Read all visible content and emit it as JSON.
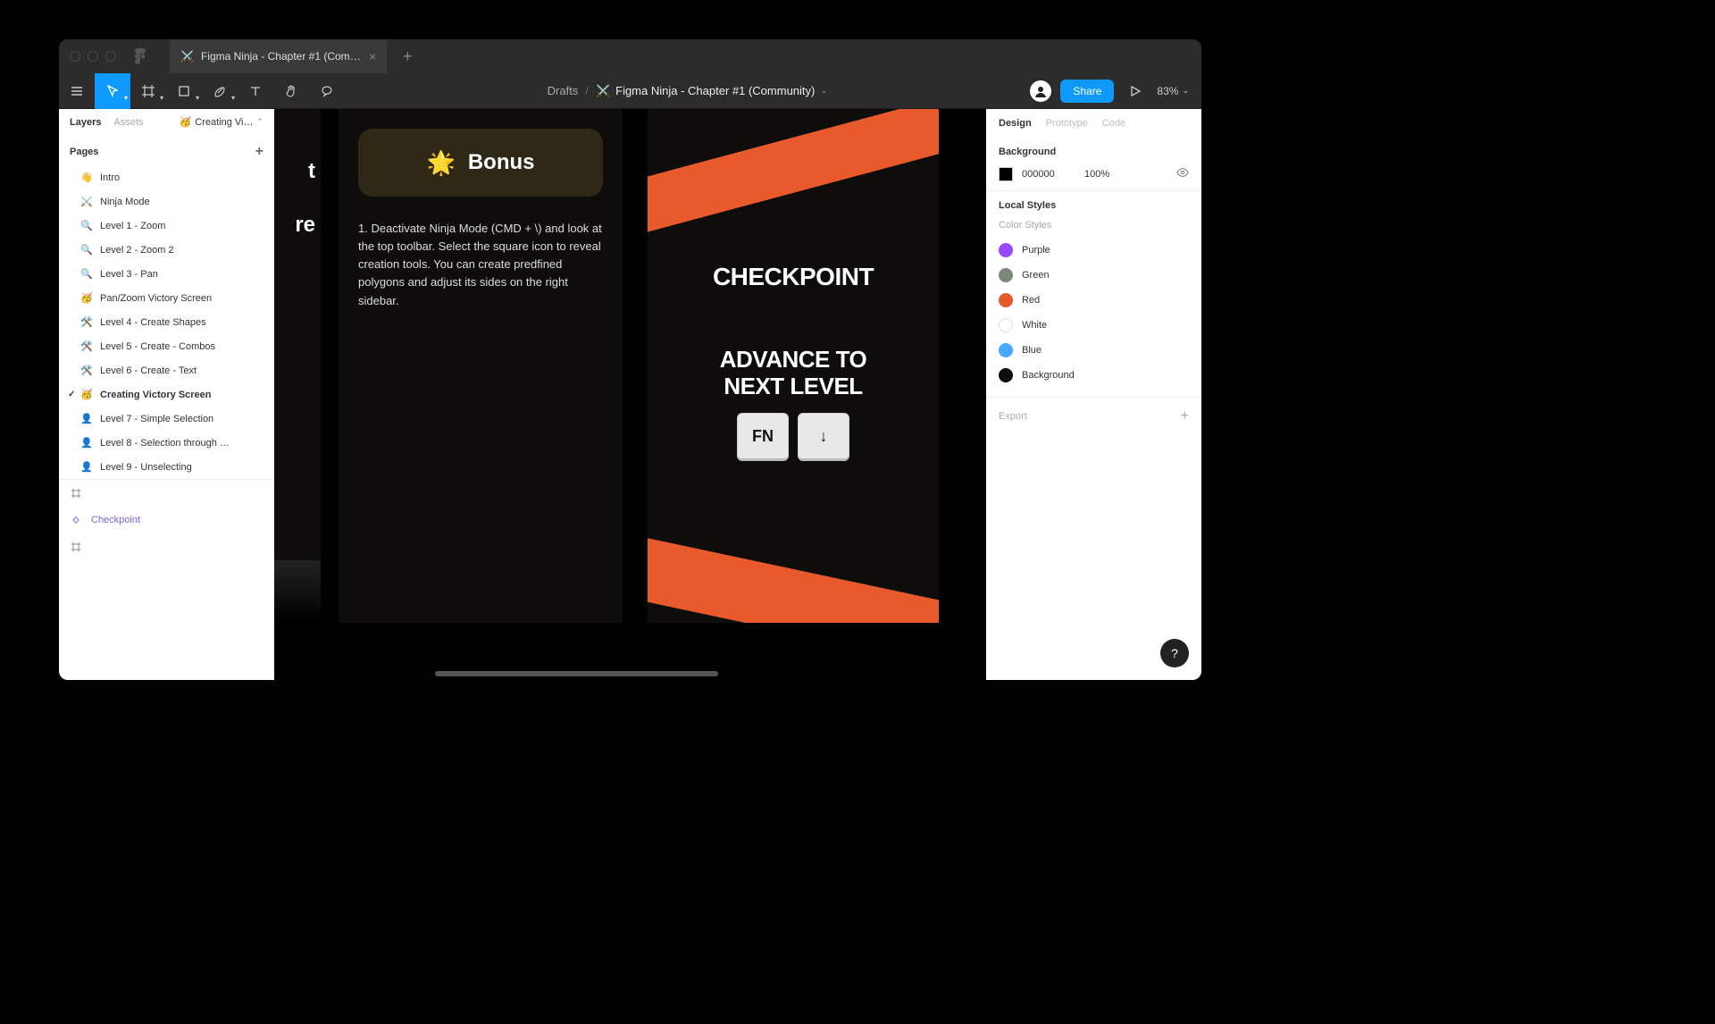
{
  "tab": {
    "title": "Figma Ninja - Chapter #1 (Comm…"
  },
  "breadcrumb": {
    "location": "Drafts",
    "title": "Figma Ninja - Chapter #1 (Community)"
  },
  "toolbar": {
    "share": "Share",
    "zoom": "83%"
  },
  "leftPanel": {
    "tabs": {
      "layers": "Layers",
      "assets": "Assets"
    },
    "currentPage": "Creating Vi…",
    "pagesHeader": "Pages",
    "pages": [
      {
        "emoji": "👋",
        "name": "Intro"
      },
      {
        "emoji": "⚔️",
        "name": "Ninja Mode"
      },
      {
        "emoji": "🔍",
        "name": "Level 1 - Zoom"
      },
      {
        "emoji": "🔍",
        "name": "Level 2 - Zoom 2"
      },
      {
        "emoji": "🔍",
        "name": "Level 3 - Pan"
      },
      {
        "emoji": "🥳",
        "name": "Pan/Zoom Victory Screen"
      },
      {
        "emoji": "🛠️",
        "name": "Level 4 - Create Shapes"
      },
      {
        "emoji": "🛠️",
        "name": "Level 5 - Create - Combos"
      },
      {
        "emoji": "🛠️",
        "name": "Level 6 - Create - Text"
      },
      {
        "emoji": "🥳",
        "name": "Creating Victory Screen",
        "selected": true
      },
      {
        "emoji": "👤",
        "name": "Level 7 - Simple Selection"
      },
      {
        "emoji": "👤",
        "name": "Level 8 - Selection through …"
      },
      {
        "emoji": "👤",
        "name": "Level 9 - Unselecting"
      }
    ],
    "layers": [
      {
        "type": "frame",
        "name": ""
      },
      {
        "type": "component",
        "name": "Checkpoint"
      },
      {
        "type": "frame",
        "name": ""
      }
    ]
  },
  "canvas": {
    "frame1": {
      "textA": "t",
      "textB": "re"
    },
    "bonus": {
      "label": "Bonus",
      "body": "1. Deactivate Ninja Mode (CMD + \\) and look at the top toolbar. Select the square icon to reveal creation tools. You can create predfined polygons and adjust its sides on the right sidebar."
    },
    "checkpoint": {
      "title": "CHECKPOINT",
      "line1": "ADVANCE TO",
      "line2": "NEXT LEVEL",
      "key1": "FN",
      "key2": "↓"
    }
  },
  "rightPanel": {
    "tabs": {
      "design": "Design",
      "prototype": "Prototype",
      "code": "Code"
    },
    "background": {
      "header": "Background",
      "hex": "000000",
      "opacity": "100%"
    },
    "localStyles": {
      "header": "Local Styles",
      "sub": "Color Styles",
      "items": [
        {
          "name": "Purple",
          "color": "#9747ff"
        },
        {
          "name": "Green",
          "color": "#7a8a7a"
        },
        {
          "name": "Red",
          "color": "#e85a2b"
        },
        {
          "name": "White",
          "color": "#ffffff",
          "border": true
        },
        {
          "name": "Blue",
          "color": "#4aa8ff"
        },
        {
          "name": "Background",
          "color": "#0e0d0c"
        }
      ]
    },
    "export": "Export"
  }
}
